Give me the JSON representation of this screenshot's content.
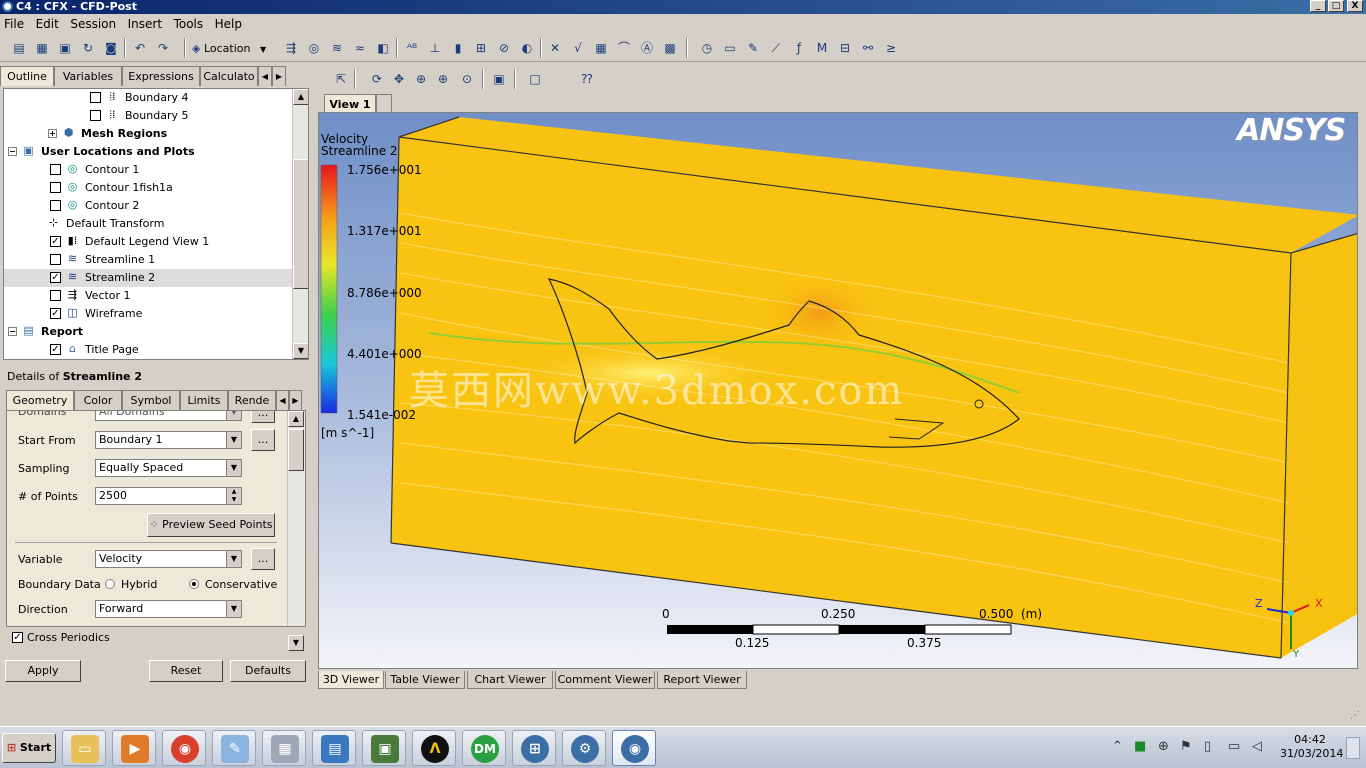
{
  "window": {
    "title": "C4 : CFX - CFD-Post",
    "min": "_",
    "max": "□",
    "close": "X"
  },
  "menu": [
    "File",
    "Edit",
    "Session",
    "Insert",
    "Tools",
    "Help"
  ],
  "toolbar": {
    "location_label": "Location"
  },
  "left_tabs": [
    "Outline",
    "Variables",
    "Expressions",
    "Calculato"
  ],
  "tree": [
    {
      "label": "Boundary 4",
      "checked": false,
      "icon": "boundary-icon"
    },
    {
      "label": "Boundary 5",
      "checked": false,
      "icon": "boundary-icon"
    },
    {
      "label": "Mesh Regions",
      "bold": true,
      "icon": "mesh-icon"
    },
    {
      "label": "User Locations and Plots",
      "bold": true,
      "icon": "folder-icon"
    },
    {
      "label": "Contour 1",
      "checked": false,
      "icon": "contour-icon"
    },
    {
      "label": "Contour 1fish1a",
      "checked": false,
      "icon": "contour-icon"
    },
    {
      "label": "Contour 2",
      "checked": false,
      "icon": "contour-icon"
    },
    {
      "label": "Default Transform",
      "icon": "transform-icon"
    },
    {
      "label": "Default Legend View 1",
      "checked": true,
      "icon": "legend-icon"
    },
    {
      "label": "Streamline 1",
      "checked": false,
      "icon": "streamline-icon"
    },
    {
      "label": "Streamline 2",
      "checked": true,
      "icon": "streamline-icon",
      "selected": true
    },
    {
      "label": "Vector 1",
      "checked": false,
      "icon": "vector-icon"
    },
    {
      "label": "Wireframe",
      "checked": true,
      "icon": "wireframe-icon"
    },
    {
      "label": "Report",
      "bold": true,
      "icon": "report-icon"
    },
    {
      "label": "Title Page",
      "checked": true,
      "icon": "title-page-icon"
    }
  ],
  "details": {
    "prefix": "Details of ",
    "object": "Streamline 2",
    "tabs": [
      "Geometry",
      "Color",
      "Symbol",
      "Limits",
      "Rende"
    ],
    "domains_label": "Domains",
    "domains_value": "All Domains",
    "start_from_label": "Start From",
    "start_from_value": "Boundary 1",
    "sampling_label": "Sampling",
    "sampling_value": "Equally Spaced",
    "points_label": "# of Points",
    "points_value": "2500",
    "preview_button": "Preview Seed Points",
    "variable_label": "Variable",
    "variable_value": "Velocity",
    "boundary_data_label": "Boundary Data",
    "hybrid_label": "Hybrid",
    "conservative_label": "Conservative",
    "direction_label": "Direction",
    "direction_value": "Forward",
    "cross_periodics_label": "Cross Periodics",
    "ellipsis": "...",
    "apply": "Apply",
    "reset": "Reset",
    "defaults": "Defaults"
  },
  "viewer": {
    "tab": "View 1",
    "legend_title": "Velocity",
    "legend_subtitle": "Streamline 2",
    "legend_values": [
      "1.756e+001",
      "1.317e+001",
      "8.786e+000",
      "4.401e+000",
      "1.541e-002"
    ],
    "legend_unit": "[m s^-1]",
    "logo": "ANSYS",
    "watermark": "莫西网www.3dmox.com",
    "scale_top": [
      "0",
      "0.250",
      "0.500",
      "(m)"
    ],
    "scale_bottom": [
      "0.125",
      "0.375"
    ],
    "axes": {
      "x": "X",
      "y": "Y",
      "z": "Z"
    }
  },
  "viewer_tabs": [
    "3D Viewer",
    "Table Viewer",
    "Chart Viewer",
    "Comment Viewer",
    "Report Viewer"
  ],
  "taskbar": {
    "start": "Start",
    "time": "04:42",
    "date": "31/03/2014"
  }
}
